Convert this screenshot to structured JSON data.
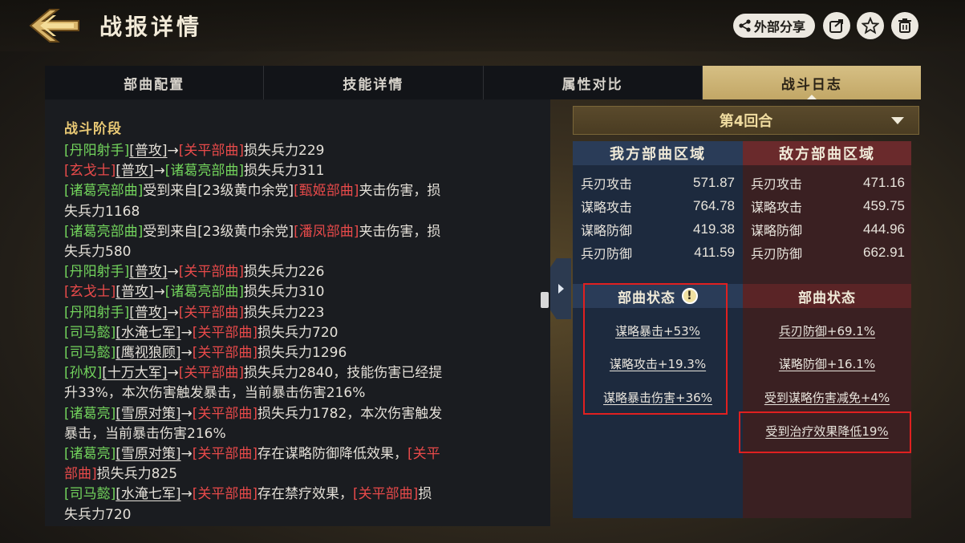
{
  "header": {
    "title": "战报详情",
    "share_label": "外部分享"
  },
  "tabs": [
    {
      "label": "部曲配置"
    },
    {
      "label": "技能详情"
    },
    {
      "label": "属性对比"
    },
    {
      "label": "战斗日志"
    }
  ],
  "log": {
    "heading": "战斗阶段",
    "lines": [
      [
        [
          "g",
          "[丹阳射手]"
        ],
        [
          "u",
          "[普攻]"
        ],
        [
          "n",
          "→"
        ],
        [
          "r",
          "[关平部曲]"
        ],
        [
          "n",
          "损失兵力229"
        ]
      ],
      [
        [
          "r",
          "[玄戈士]"
        ],
        [
          "u",
          "[普攻]"
        ],
        [
          "n",
          "→"
        ],
        [
          "g",
          "[诸葛亮部曲]"
        ],
        [
          "n",
          "损失兵力311"
        ]
      ],
      [
        [
          "g",
          "[诸葛亮部曲]"
        ],
        [
          "n",
          "受到来自[23级黄巾余党]"
        ],
        [
          "r",
          "[甄姬部曲]"
        ],
        [
          "n",
          "夹击伤害，损"
        ]
      ],
      [
        [
          "n",
          "失兵力1168"
        ]
      ],
      [
        [
          "g",
          "[诸葛亮部曲]"
        ],
        [
          "n",
          "受到来自[23级黄巾余党]"
        ],
        [
          "r",
          "[潘凤部曲]"
        ],
        [
          "n",
          "夹击伤害，损"
        ]
      ],
      [
        [
          "n",
          "失兵力580"
        ]
      ],
      [
        [
          "g",
          "[丹阳射手]"
        ],
        [
          "u",
          "[普攻]"
        ],
        [
          "n",
          "→"
        ],
        [
          "r",
          "[关平部曲]"
        ],
        [
          "n",
          "损失兵力226"
        ]
      ],
      [
        [
          "r",
          "[玄戈士]"
        ],
        [
          "u",
          "[普攻]"
        ],
        [
          "n",
          "→"
        ],
        [
          "g",
          "[诸葛亮部曲]"
        ],
        [
          "n",
          "损失兵力310"
        ]
      ],
      [
        [
          "g",
          "[丹阳射手]"
        ],
        [
          "u",
          "[普攻]"
        ],
        [
          "n",
          "→"
        ],
        [
          "r",
          "[关平部曲]"
        ],
        [
          "n",
          "损失兵力223"
        ]
      ],
      [
        [
          "g",
          "[司马懿]"
        ],
        [
          "u",
          "[水淹七军]"
        ],
        [
          "n",
          "→"
        ],
        [
          "r",
          "[关平部曲]"
        ],
        [
          "n",
          "损失兵力720"
        ]
      ],
      [
        [
          "g",
          "[司马懿]"
        ],
        [
          "u",
          "[鹰视狼顾]"
        ],
        [
          "n",
          "→"
        ],
        [
          "r",
          "[关平部曲]"
        ],
        [
          "n",
          "损失兵力1296"
        ]
      ],
      [
        [
          "g",
          "[孙权]"
        ],
        [
          "u",
          "[十万大军]"
        ],
        [
          "n",
          "→"
        ],
        [
          "r",
          "[关平部曲]"
        ],
        [
          "n",
          "损失兵力2840，技能伤害已经提"
        ]
      ],
      [
        [
          "n",
          "升33%，本次伤害触发暴击，当前暴击伤害216%"
        ]
      ],
      [
        [
          "g",
          "[诸葛亮]"
        ],
        [
          "u",
          "[雪原对策]"
        ],
        [
          "n",
          "→"
        ],
        [
          "r",
          "[关平部曲]"
        ],
        [
          "n",
          "损失兵力1782，本次伤害触发"
        ]
      ],
      [
        [
          "n",
          "暴击，当前暴击伤害216%"
        ]
      ],
      [
        [
          "g",
          "[诸葛亮]"
        ],
        [
          "u",
          "[雪原对策]"
        ],
        [
          "n",
          "→"
        ],
        [
          "r",
          "[关平部曲]"
        ],
        [
          "n",
          "存在谋略防御降低效果，"
        ],
        [
          "r",
          "[关平"
        ]
      ],
      [
        [
          "r",
          "部曲]"
        ],
        [
          "n",
          "损失兵力825"
        ]
      ],
      [
        [
          "g",
          "[司马懿]"
        ],
        [
          "u",
          "[水淹七军]"
        ],
        [
          "n",
          "→"
        ],
        [
          "r",
          "[关平部曲]"
        ],
        [
          "n",
          "存在禁疗效果，"
        ],
        [
          "r",
          "[关平部曲]"
        ],
        [
          "n",
          "损"
        ]
      ],
      [
        [
          "n",
          "失兵力720"
        ]
      ]
    ]
  },
  "round_selector": {
    "label": "第4回合"
  },
  "ally": {
    "heading": "我方部曲区域",
    "stats": [
      {
        "name": "兵刃攻击",
        "value": "571.87"
      },
      {
        "name": "谋略攻击",
        "value": "764.78"
      },
      {
        "name": "谋略防御",
        "value": "419.38"
      },
      {
        "name": "兵刃防御",
        "value": "411.59"
      }
    ],
    "status_heading": "部曲状态",
    "status_warn": "!",
    "statuses": [
      "谋略暴击+53%",
      "谋略攻击+19.3%",
      "谋略暴击伤害+36%"
    ]
  },
  "enemy": {
    "heading": "敌方部曲区域",
    "stats": [
      {
        "name": "兵刃攻击",
        "value": "471.16"
      },
      {
        "name": "谋略攻击",
        "value": "459.75"
      },
      {
        "name": "谋略防御",
        "value": "444.96"
      },
      {
        "name": "兵刃防御",
        "value": "662.91"
      }
    ],
    "status_heading": "部曲状态",
    "statuses": [
      "兵刃防御+69.1%",
      "谋略防御+16.1%",
      "受到谋略伤害减免+4%",
      "受到治疗效果降低19%"
    ]
  },
  "colors": {
    "ally_green": "#72d45c",
    "enemy_red": "#e84a4a",
    "tab_active_gold": "#d6bf84",
    "heading_gold": "#e8c874",
    "highlight_red": "#e02020"
  }
}
